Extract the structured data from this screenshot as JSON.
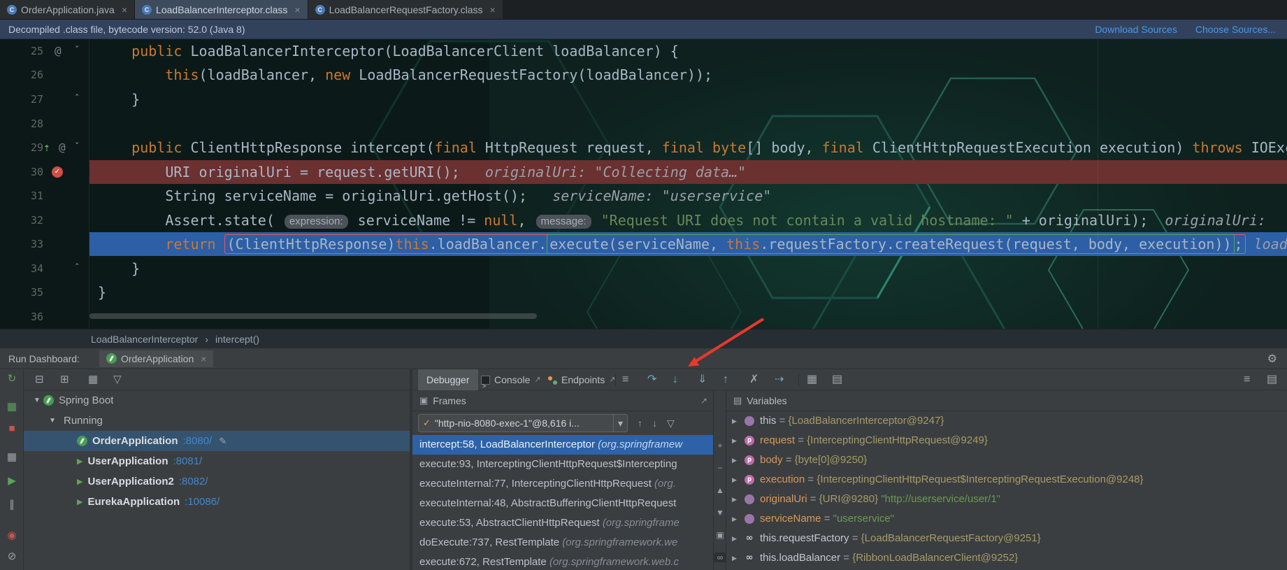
{
  "colors": {
    "keyword_orange": "#cc7832",
    "string_green": "#6a8759",
    "code_text": "#a9b7c6",
    "exec_line_blue": "#2d5fa6",
    "breakpoint_line_red": "#6b3030",
    "frame_selection_blue": "#2d62a8",
    "link_blue": "#459ae8",
    "port_blue": "#3f87cc",
    "spring_green": "#499c54",
    "annotation_arrow_red": "#e8392b"
  },
  "icons": {
    "class_letter": "C",
    "close": "×",
    "caret_down": "▾",
    "breadcrumb_sep": "›",
    "gear": "⚙",
    "rerun": "↻",
    "collapse_all": "⊟",
    "expand_all": "⊞",
    "group_by": "▦",
    "filter": "▽",
    "dashboard_grid": "▦",
    "stop": "■",
    "restore_layout": "▦",
    "resume": "▶",
    "pause": "∥",
    "view_breakpoints": "◉",
    "mute_breakpoints": "⊘",
    "hamburger": "≡",
    "step_over": "↷",
    "step_into": "↓",
    "force_step_into": "⇓",
    "step_out": "↑",
    "drop_frame": "✗",
    "run_to_cursor": "⇢",
    "evaluate": "▦",
    "layout_panel": "▤",
    "menu": "≡",
    "thread_check": "✓",
    "frame_up": "↑",
    "frame_down": "↓",
    "plus": "+",
    "minus": "−",
    "tri_up": "▲",
    "tri_down": "▼",
    "copy_frame": "▣",
    "watch": "∞",
    "pencil": "✎",
    "at": "@",
    "fold_open": "ˇ",
    "fold_close": "ˆ",
    "impl_arrow": "⇡",
    "expander_open": "▼",
    "expander_closed": "▶",
    "play": "▶",
    "external": "↗",
    "frames_panel": "▣",
    "vars_panel": "▤",
    "param_letter": "p"
  },
  "tabs": [
    {
      "label": "OrderApplication.java",
      "active": false
    },
    {
      "label": "LoadBalancerInterceptor.class",
      "active": true
    },
    {
      "label": "LoadBalancerRequestFactory.class",
      "active": false
    }
  ],
  "notification": {
    "text": "Decompiled .class file, bytecode version: 52.0 (Java 8)",
    "links": [
      "Download Sources",
      "Choose Sources..."
    ]
  },
  "editor": {
    "lines": [
      {
        "num": "25",
        "segs": [
          {
            "t": "    ",
            "c": "pl"
          },
          {
            "t": "public ",
            "c": "kw"
          },
          {
            "t": "LoadBalancerInterceptor(LoadBalancerClient loadBalancer) {",
            "c": "pl"
          }
        ]
      },
      {
        "num": "26",
        "segs": [
          {
            "t": "        ",
            "c": "pl"
          },
          {
            "t": "this",
            "c": "kw"
          },
          {
            "t": "(loadBalancer, ",
            "c": "pl"
          },
          {
            "t": "new ",
            "c": "kw"
          },
          {
            "t": "LoadBalancerRequestFactory(loadBalancer));",
            "c": "p l"
          }
        ]
      },
      {
        "num": "27",
        "segs": [
          {
            "t": "    }",
            "c": "pl"
          }
        ]
      },
      {
        "num": "28",
        "segs": []
      },
      {
        "num": "29",
        "segs": [
          {
            "t": "    ",
            "c": "pl"
          },
          {
            "t": "public ",
            "c": "kw"
          },
          {
            "t": "ClientHttpResponse intercept(",
            "c": "pl"
          },
          {
            "t": "final ",
            "c": "kw"
          },
          {
            "t": "HttpRequest request, ",
            "c": "pl"
          },
          {
            "t": "final byte",
            "c": "kw"
          },
          {
            "t": "[] body, ",
            "c": "pl"
          },
          {
            "t": "final ",
            "c": "kw"
          },
          {
            "t": "ClientHttpRequestExecution execution) ",
            "c": "pl"
          },
          {
            "t": "throws ",
            "c": "kw"
          },
          {
            "t": "IOException {",
            "c": "pl"
          }
        ]
      },
      {
        "num": "30",
        "segs": [
          {
            "t": "        ",
            "c": "pl"
          },
          {
            "t": "URI originalUri = request.getURI();",
            "c": "pl"
          },
          {
            "t": "   ",
            "c": "pl"
          },
          {
            "t": "originalUri: \"Collecting data…\"",
            "c": "hint"
          }
        ]
      },
      {
        "num": "31",
        "segs": [
          {
            "t": "        ",
            "c": "pl"
          },
          {
            "t": "String serviceName = originalUri.getHost();",
            "c": "pl"
          },
          {
            "t": "   ",
            "c": "pl"
          },
          {
            "t": "serviceName: \"userservice\"",
            "c": "hint"
          }
        ]
      },
      {
        "num": "32",
        "segs": [
          {
            "t": "        ",
            "c": "pl"
          },
          {
            "t": "Assert.state( ",
            "c": "pl"
          },
          {
            "t": "expression:",
            "c": "badge"
          },
          {
            "t": " serviceName != ",
            "c": "pl"
          },
          {
            "t": "null",
            "c": "kw"
          },
          {
            "t": ", ",
            "c": "pl"
          },
          {
            "t": "message:",
            "c": "badge"
          },
          {
            "t": " ",
            "c": "pl"
          },
          {
            "t": "\"Request URI does not contain a valid hostname: \"",
            "c": "str"
          },
          {
            "t": " + originalUri);",
            "c": "pl"
          },
          {
            "t": "  ",
            "c": "pl"
          },
          {
            "t": "originalUri: ",
            "c": "hint"
          }
        ]
      },
      {
        "num": "33"
      },
      {
        "num": "34",
        "segs": [
          {
            "t": "    }",
            "c": "pl"
          }
        ]
      },
      {
        "num": "35",
        "segs": [
          {
            "t": "}",
            "c": "pl"
          }
        ]
      },
      {
        "num": "36",
        "segs": []
      }
    ],
    "line33": {
      "indent": "        ",
      "kw": "return ",
      "cast": "(ClientHttpResponse)",
      "this1": "this",
      "lb": ".loadBalancer.",
      "exec1": "execute(serviceName, ",
      "this2": "this",
      "exec2": ".requestFactory.createRequest(request, body, execution))",
      "semi": ";",
      "hint": " loadBa"
    }
  },
  "breadcrumbs": [
    "LoadBalancerInterceptor",
    "intercept()"
  ],
  "run_dashboard": {
    "label": "Run Dashboard:",
    "tab": "OrderApplication",
    "tree": [
      {
        "label": "Spring Boot"
      },
      {
        "label": "Running"
      },
      {
        "label": "OrderApplication",
        "port": ":8080/"
      },
      {
        "label": "UserApplication",
        "port": ":8081/"
      },
      {
        "label": "UserApplication2",
        "port": ":8082/"
      },
      {
        "label": "EurekaApplication",
        "port": ":10086/"
      }
    ]
  },
  "debugger": {
    "tabs": [
      "Debugger",
      "Console",
      "Endpoints"
    ],
    "frames": {
      "title": "Frames",
      "thread": "\"http-nio-8080-exec-1\"@8,616 i...",
      "rows": [
        {
          "m": "intercept:58, LoadBalancerInterceptor ",
          "p": "(org.springframew"
        },
        {
          "m": "execute:93, InterceptingClientHttpRequest$Intercepting",
          "p": ""
        },
        {
          "m": "executeInternal:77, InterceptingClientHttpRequest ",
          "p": "(org."
        },
        {
          "m": "executeInternal:48, AbstractBufferingClientHttpRequest",
          "p": ""
        },
        {
          "m": "execute:53, AbstractClientHttpRequest ",
          "p": "(org.springframe"
        },
        {
          "m": "doExecute:737, RestTemplate ",
          "p": "(org.springframework.we"
        },
        {
          "m": "execute:672, RestTemplate ",
          "p": "(org.springframework.web.c"
        }
      ]
    },
    "variables": {
      "title": "Variables",
      "rows": [
        {
          "name": "this",
          "eq": " = ",
          "value": "{LoadBalancerInterceptor@9247}",
          "str": ""
        },
        {
          "name": "request",
          "eq": " = ",
          "value": "{InterceptingClientHttpRequest@9249}",
          "str": ""
        },
        {
          "name": "body",
          "eq": " = ",
          "value": "{byte[0]@9250}",
          "str": ""
        },
        {
          "name": "execution",
          "eq": " = ",
          "value": "{InterceptingClientHttpRequest$InterceptingRequestExecution@9248}",
          "str": ""
        },
        {
          "name": "originalUri",
          "eq": " = ",
          "value": "{URI@9280} ",
          "str": "\"http://userservice/user/1\""
        },
        {
          "name": "serviceName",
          "eq": " = ",
          "value": "",
          "str": "\"userservice\""
        },
        {
          "name": "this.requestFactory",
          "eq": " = ",
          "value": "{LoadBalancerRequestFactory@9251}",
          "str": ""
        },
        {
          "name": "this.loadBalancer",
          "eq": " = ",
          "value": "{RibbonLoadBalancerClient@9252}",
          "str": ""
        }
      ]
    }
  }
}
